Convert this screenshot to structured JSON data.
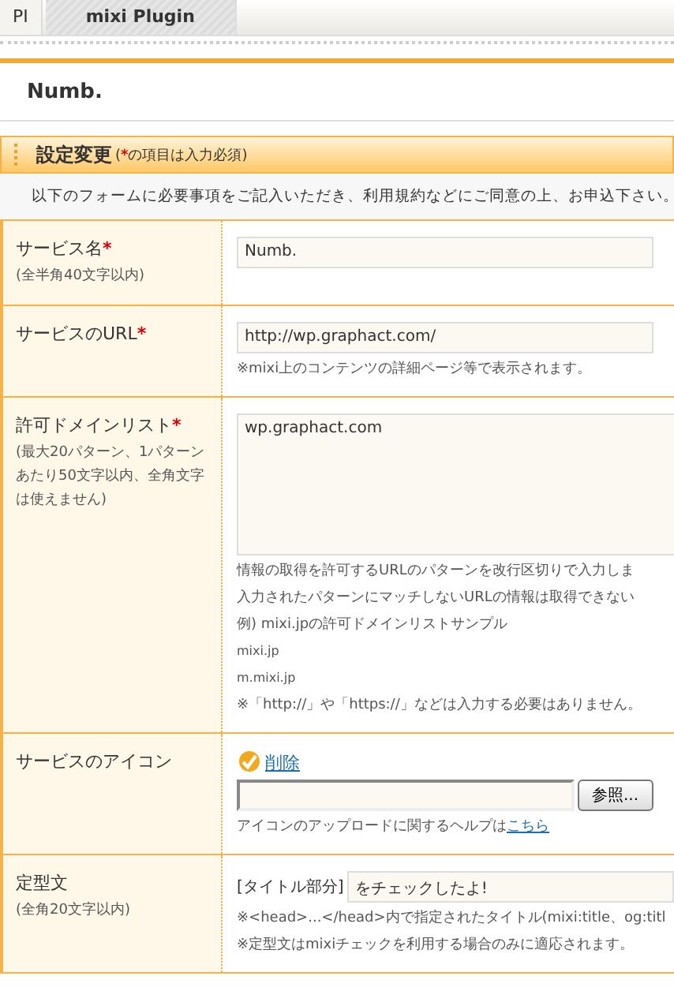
{
  "tabs": [
    {
      "label": "PI",
      "selected": false
    },
    {
      "label": "mixi Plugin",
      "selected": true
    }
  ],
  "title": "Numb.",
  "section": {
    "heading": "設定変更",
    "note_open": "(",
    "note_mark": "*",
    "note_text": "の項目は入力必須)"
  },
  "intro": "以下のフォームに必要事項をご記入いただき、利用規約などにご同意の上、お申込下さい。",
  "rows": [
    {
      "kind": "text",
      "label": "サービス名",
      "mark": "*",
      "hint": "(全半角40文字以内)",
      "value": "Numb."
    },
    {
      "kind": "text",
      "label": "サービスのURL",
      "mark": "*",
      "value": "http://wp.graphact.com/",
      "notes": [
        "※mixi上のコンテンツの詳細ページ等で表示されます。"
      ]
    },
    {
      "kind": "textarea",
      "label": "許可ドメインリスト",
      "mark": "*",
      "hint": "(最大20パターン、1パターンあたり50文字以内、全角文字は使えません)",
      "value": "wp.graphact.com",
      "notes": [
        "情報の取得を許可するURLのパターンを改行区切りで入力しま",
        "入力されたパターンにマッチしないURLの情報は取得できない",
        "例) mixi.jpの許可ドメインリストサンプル",
        "mixi.jp",
        "m.mixi.jp",
        "※「http://」や「https://」などは入力する必要はありません。"
      ]
    },
    {
      "kind": "file",
      "label": "サービスのアイコン",
      "delete_link": "削除",
      "button": "参照...",
      "help": "アイコンのアップロードに関するヘルプは",
      "help_link": "こちら"
    },
    {
      "kind": "prefixed",
      "label": "定型文",
      "hint": "(全角20文字以内)",
      "prefix": "[タイトル部分]",
      "value": "をチェックしたよ!",
      "notes": [
        "※<head>...</head>内で指定されたタイトル(mixi:title、og:titl",
        "※定型文はmixiチェックを利用する場合のみに適応されます。"
      ]
    }
  ]
}
